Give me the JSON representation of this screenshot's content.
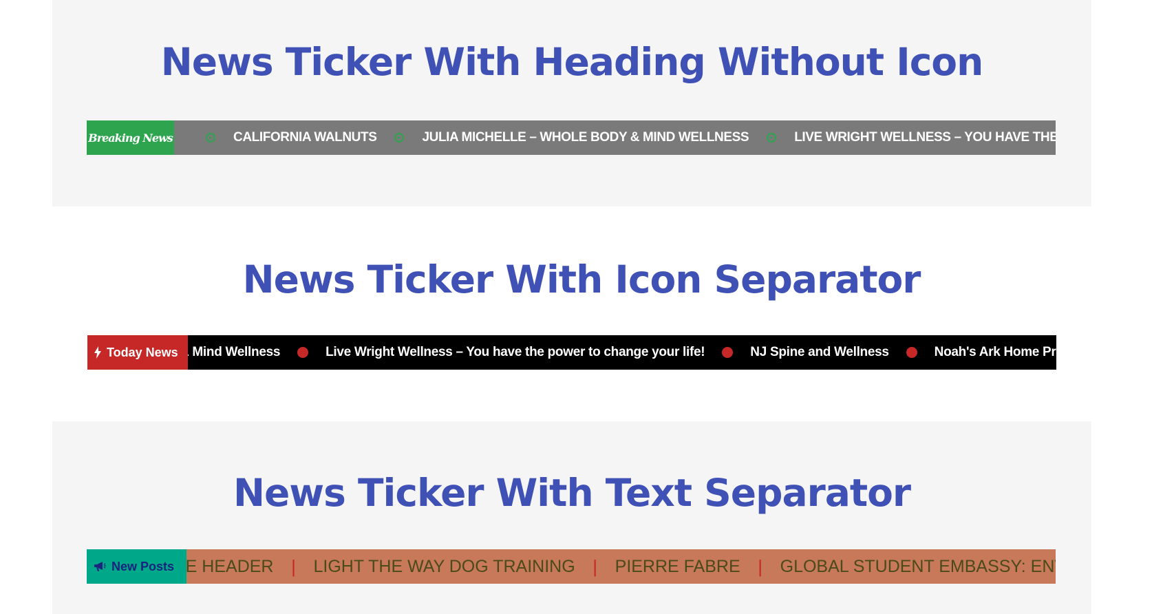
{
  "sections": {
    "heading_without_icon": {
      "title": "News Ticker With Heading Without Icon",
      "label": "Breaking News",
      "separator_icon": "circle-arrow-icon",
      "colors": {
        "label_bg": "#2ea44f",
        "bar_bg": "#7a7a7a"
      },
      "items": [
        "CALIFORNIA WALNUTS",
        "JULIA MICHELLE – WHOLE BODY & MIND WELLNESS",
        "LIVE WRIGHT WELLNESS – YOU HAVE THE POWER"
      ]
    },
    "icon_separator": {
      "title": "News Ticker With Icon Separator",
      "label": "Today News",
      "label_icon": "bolt-icon",
      "separator_icon": "red-dot-icon",
      "colors": {
        "label_bg": "#c62828",
        "bar_bg": "#000000"
      },
      "items": [
        "& Mind Wellness",
        "Live Wright Wellness – You have the power to change your life!",
        "NJ Spine and Wellness",
        "Noah's Ark Home Prepar"
      ]
    },
    "text_separator": {
      "title": "News Ticker With Text Separator",
      "label": "New Posts",
      "label_icon": "megaphone-icon",
      "separator_text": "|",
      "colors": {
        "label_bg": "#00a88a",
        "bar_bg": "#c8795a"
      },
      "items": [
        "VE HEADER",
        "LIGHT THE WAY DOG TRAINING",
        "PIERRE FABRE",
        "GLOBAL STUDENT EMBASSY: ENV"
      ]
    }
  }
}
